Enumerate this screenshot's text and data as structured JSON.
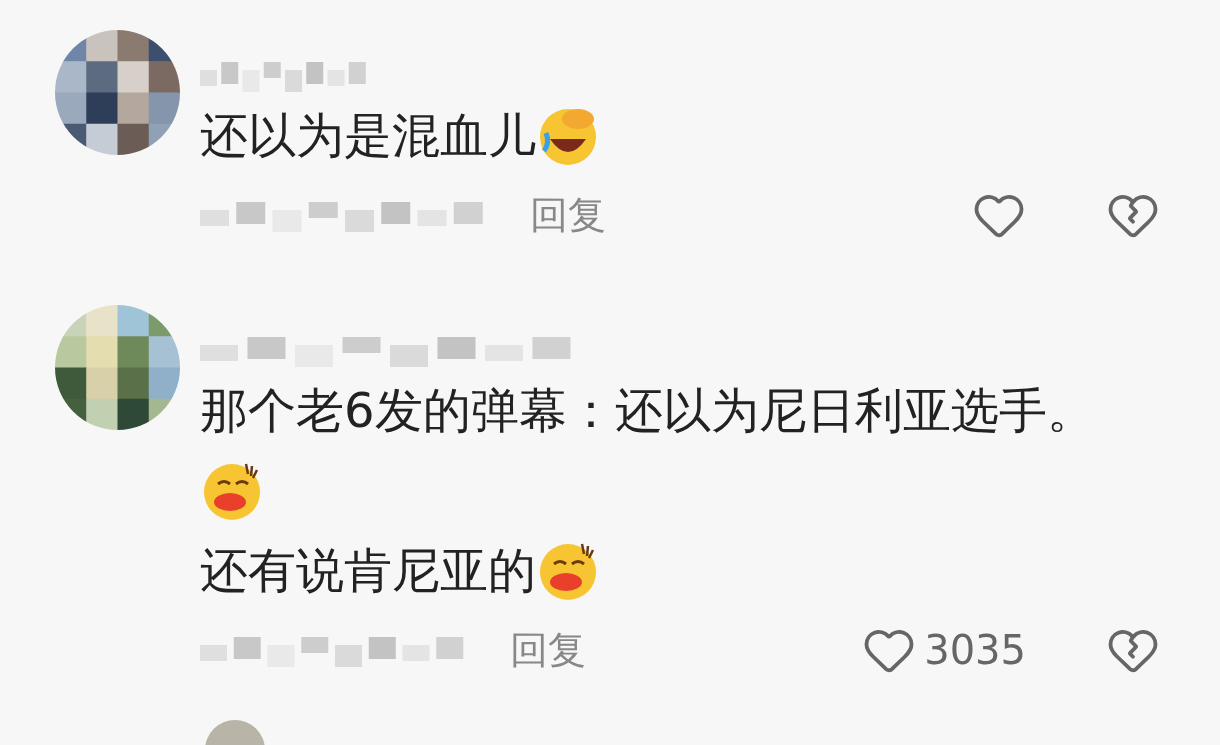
{
  "comments": [
    {
      "lines": [
        {
          "kind": "text_emoji",
          "text": "还以为是混血儿",
          "emoji": {
            "kind": "laugh"
          }
        }
      ],
      "reply": "回复"
    },
    {
      "lines": [
        {
          "kind": "text",
          "text": "那个老6发的弹幕：还以为尼日利亚选手。"
        },
        {
          "kind": "emoji",
          "emoji": {
            "kind": "duck"
          }
        },
        {
          "kind": "text_emoji",
          "text": "还有说肯尼亚的",
          "emoji": {
            "kind": "duck"
          }
        }
      ],
      "reply": "回复",
      "likes": "3035"
    }
  ]
}
